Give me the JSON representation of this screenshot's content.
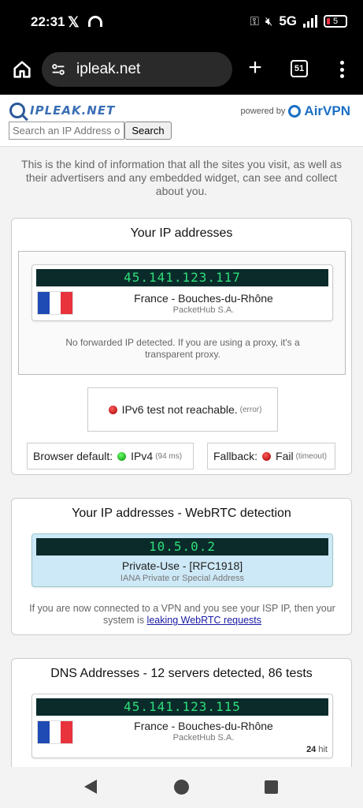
{
  "status": {
    "time": "22:31",
    "network": "5G",
    "battery": "5",
    "icons": [
      "x-icon",
      "app-icon",
      "key-icon",
      "mute-icon",
      "signal-icon",
      "battery-icon"
    ]
  },
  "browser": {
    "url": "ipleak.net",
    "tab_count": "51",
    "icons": [
      "home-icon",
      "tune-icon",
      "plus-icon",
      "tabs-icon",
      "menu-icon"
    ]
  },
  "site": {
    "logo_text": "IPLEAK.NET",
    "powered_by": "powered by",
    "airvpn": "AirVPN",
    "search_placeholder": "Search an IP Address or Hostname",
    "search_button": "Search"
  },
  "intro": "This is the kind of information that all the sites you visit, as well as their advertisers and any embedded widget, can see and collect about you.",
  "ip_section": {
    "title": "Your IP addresses",
    "ip": "45.141.123.117",
    "location": "France - Bouches-du-Rhône",
    "isp": "PacketHub S.A.",
    "forward_note": "No forwarded IP detected. If you are using a proxy, it's a transparent proxy.",
    "ipv6_label": "IPv6 test not reachable.",
    "ipv6_status": "(error)",
    "browser_default_label": "Browser default:",
    "browser_default_value": "IPv4",
    "browser_default_time": "(94 ms)",
    "fallback_label": "Fallback:",
    "fallback_value": "Fail",
    "fallback_status": "(timeout)"
  },
  "webrtc_section": {
    "title": "Your IP addresses - WebRTC detection",
    "ip": "10.5.0.2",
    "location": "Private-Use - [RFC1918]",
    "isp": "IANA Private or Special Address",
    "note_before": "If you are now connected to a VPN and you see your ISP IP, then your system is ",
    "note_link": "leaking WebRTC requests"
  },
  "dns_section": {
    "title": "DNS Addresses - 12 servers detected, 86 tests",
    "ip": "45.141.123.115",
    "location": "France - Bouches-du-Rhône",
    "isp": "PacketHub S.A.",
    "hits": "24",
    "hits_label": "hit"
  },
  "colors": {
    "ip_text": "#2ee07a",
    "ip_bg": "#0b2b2b",
    "flag_blue": "#1f4bb5",
    "flag_white": "#ffffff",
    "flag_red": "#e8323c",
    "brand": "#1a6fc4"
  },
  "nav": {
    "icons": [
      "back-icon",
      "home-nav-icon",
      "recent-icon"
    ]
  }
}
